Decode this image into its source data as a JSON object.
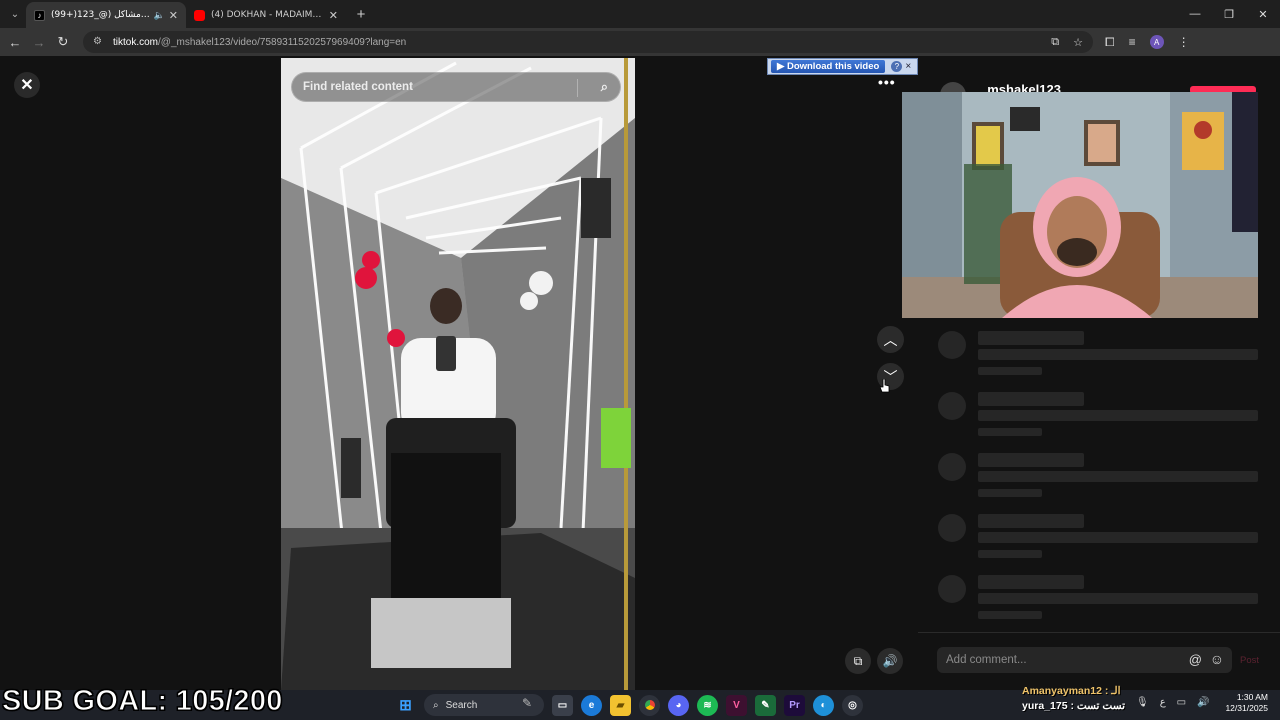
{
  "browser": {
    "tabs": [
      {
        "title": "(99+)الكروان مشاكل (@_123",
        "active": true,
        "favicon_color": "#000000",
        "has_audio": true
      },
      {
        "title": "(4) DOKHAN - MADAIMADAI",
        "active": false,
        "favicon_color": "#ff0000",
        "has_audio": false
      }
    ],
    "url_host": "tiktok.com",
    "url_rest": "/@_mshakel123/video/7589311520257969409?lang=en",
    "profile_initial": "A"
  },
  "tiktok": {
    "search_placeholder": "Find related content",
    "author": "_mshakel123",
    "comment_placeholder": "Add comment...",
    "post_label": "Post"
  },
  "download_extension": {
    "button_label": "Download this video",
    "help_label": "?",
    "close_label": "×"
  },
  "stream_overlay": {
    "sub_goal": "SUB GOAL: 105/200",
    "chat_line1": "Amanyayman12 : الـ",
    "chat_line2": "yura_175 : تست تست"
  },
  "taskbar": {
    "search_label": "Search",
    "tray_lang": "ع",
    "clock_time": "1:30 AM",
    "clock_date": "12/31/2025"
  }
}
